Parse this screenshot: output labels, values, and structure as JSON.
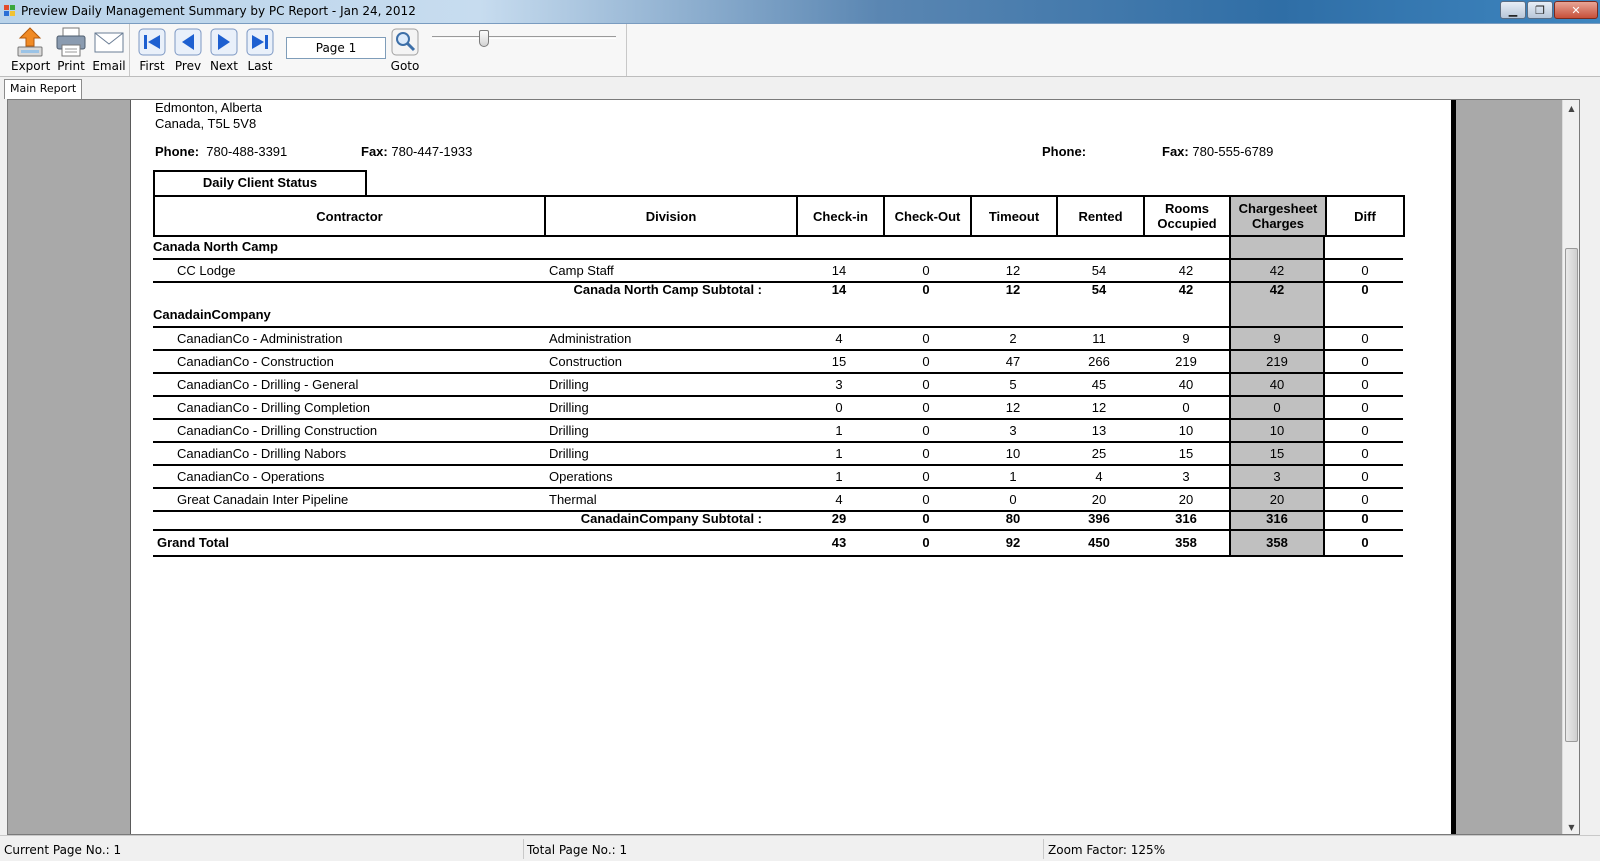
{
  "window": {
    "title": "Preview Daily Management Summary by PC Report - Jan 24, 2012",
    "min_label": "▁",
    "max_label": "❐",
    "close_label": "✕"
  },
  "toolbar": {
    "export": "Export",
    "print": "Print",
    "email": "Email",
    "first": "First",
    "prev": "Prev",
    "next": "Next",
    "last": "Last",
    "page_value": "Page 1",
    "goto": "Goto",
    "zoom_slider_fraction": 0.27
  },
  "tabs": {
    "main_report": "Main Report"
  },
  "report": {
    "address_line1": "Edmonton, Alberta",
    "address_line2": "Canada,  T5L 5V8",
    "phone_label": "Phone:",
    "phone_value": "780-488-3391",
    "fax_label": "Fax:",
    "fax_value": "780-447-1933",
    "phone2_label": "Phone:",
    "phone2_value": "",
    "fax2_label": "Fax:",
    "fax2_value": "780-555-6789",
    "section_title": "Daily Client Status",
    "headers": {
      "contractor": "Contractor",
      "division": "Division",
      "checkin": "Check-in",
      "checkout": "Check-Out",
      "timeout": "Timeout",
      "rented": "Rented",
      "rooms_occupied": "Rooms Occupied",
      "chargesheet": "Chargesheet Charges",
      "diff": "Diff"
    },
    "groups": [
      {
        "name": "Canada North Camp",
        "rows": [
          {
            "contractor": "CC Lodge",
            "division": "Camp Staff",
            "checkin": "14",
            "checkout": "0",
            "timeout": "12",
            "rented": "54",
            "rooms": "42",
            "charges": "42",
            "diff": "0"
          }
        ],
        "subtotal": {
          "label": "Canada North Camp Subtotal :",
          "checkin": "14",
          "checkout": "0",
          "timeout": "12",
          "rented": "54",
          "rooms": "42",
          "charges": "42",
          "diff": "0"
        }
      },
      {
        "name": "CanadainCompany",
        "rows": [
          {
            "contractor": "CanadianCo - Administration",
            "division": "Administration",
            "checkin": "4",
            "checkout": "0",
            "timeout": "2",
            "rented": "11",
            "rooms": "9",
            "charges": "9",
            "diff": "0"
          },
          {
            "contractor": "CanadianCo - Construction",
            "division": "Construction",
            "checkin": "15",
            "checkout": "0",
            "timeout": "47",
            "rented": "266",
            "rooms": "219",
            "charges": "219",
            "diff": "0"
          },
          {
            "contractor": "CanadianCo - Drilling - General",
            "division": "Drilling",
            "checkin": "3",
            "checkout": "0",
            "timeout": "5",
            "rented": "45",
            "rooms": "40",
            "charges": "40",
            "diff": "0"
          },
          {
            "contractor": "CanadianCo - Drilling Completion",
            "division": "Drilling",
            "checkin": "0",
            "checkout": "0",
            "timeout": "12",
            "rented": "12",
            "rooms": "0",
            "charges": "0",
            "diff": "0"
          },
          {
            "contractor": "CanadianCo - Drilling Construction",
            "division": "Drilling",
            "checkin": "1",
            "checkout": "0",
            "timeout": "3",
            "rented": "13",
            "rooms": "10",
            "charges": "10",
            "diff": "0"
          },
          {
            "contractor": "CanadianCo - Drilling Nabors",
            "division": "Drilling",
            "checkin": "1",
            "checkout": "0",
            "timeout": "10",
            "rented": "25",
            "rooms": "15",
            "charges": "15",
            "diff": "0"
          },
          {
            "contractor": "CanadianCo - Operations",
            "division": "Operations",
            "checkin": "1",
            "checkout": "0",
            "timeout": "1",
            "rented": "4",
            "rooms": "3",
            "charges": "3",
            "diff": "0"
          },
          {
            "contractor": "Great Canadain Inter Pipeline",
            "division": "Thermal",
            "checkin": "4",
            "checkout": "0",
            "timeout": "0",
            "rented": "20",
            "rooms": "20",
            "charges": "20",
            "diff": "0"
          }
        ],
        "subtotal": {
          "label": "CanadainCompany Subtotal :",
          "checkin": "29",
          "checkout": "0",
          "timeout": "80",
          "rented": "396",
          "rooms": "316",
          "charges": "316",
          "diff": "0"
        }
      }
    ],
    "grand_total": {
      "label": "Grand Total",
      "checkin": "43",
      "checkout": "0",
      "timeout": "92",
      "rented": "450",
      "rooms": "358",
      "charges": "358",
      "diff": "0"
    }
  },
  "status": {
    "current_page": "Current Page No.: 1",
    "total_page": "Total Page No.: 1",
    "zoom": "Zoom Factor: 125%"
  },
  "colors": {
    "highlight_column": "#c0c0c0",
    "viewer_background": "#a9a9a9"
  }
}
